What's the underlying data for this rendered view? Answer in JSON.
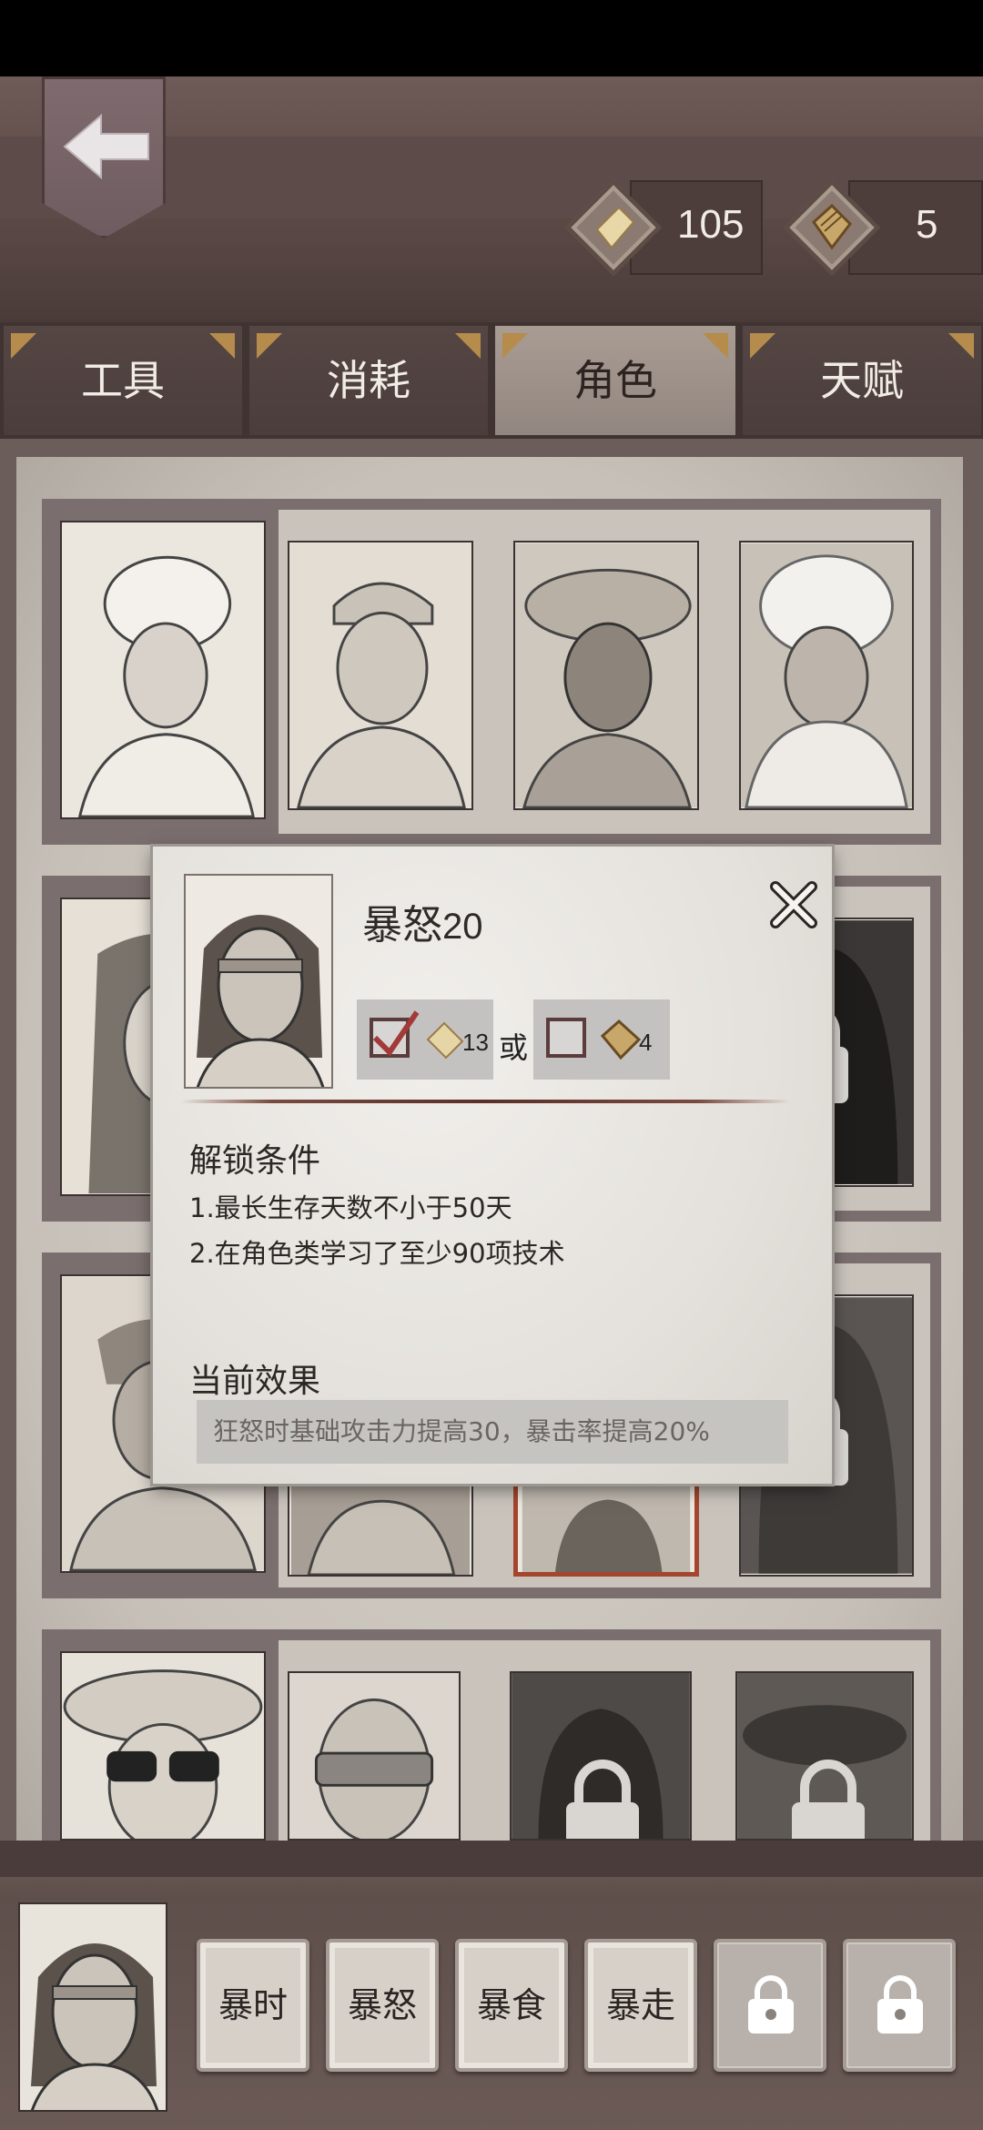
{
  "header": {
    "currency": [
      {
        "icon": "scroll-icon",
        "value": "105"
      },
      {
        "icon": "book-icon",
        "value": "5"
      }
    ]
  },
  "tabs": [
    {
      "label": "工具",
      "active": false
    },
    {
      "label": "消耗",
      "active": false
    },
    {
      "label": "角色",
      "active": true
    },
    {
      "label": "天赋",
      "active": false
    }
  ],
  "popup": {
    "title": "暴怒",
    "level": "20",
    "options": [
      {
        "checked": true,
        "icon": "scroll-icon",
        "cost": "13"
      },
      {
        "checked": false,
        "icon": "book-icon",
        "cost": "4"
      }
    ],
    "or_text": "或",
    "unlock_heading": "解锁条件",
    "conditions": [
      "1.最长生存天数不小于50天",
      "2.在角色类学习了至少90项技术"
    ],
    "effect_heading": "当前效果",
    "effect_text": "狂怒时基础攻击力提高30，暴击率提高20%"
  },
  "skills": [
    {
      "label": "暴时",
      "locked": false
    },
    {
      "label": "暴怒",
      "locked": false
    },
    {
      "label": "暴食",
      "locked": false
    },
    {
      "label": "暴走",
      "locked": false
    },
    {
      "label": "",
      "locked": true
    },
    {
      "label": "",
      "locked": true
    }
  ]
}
